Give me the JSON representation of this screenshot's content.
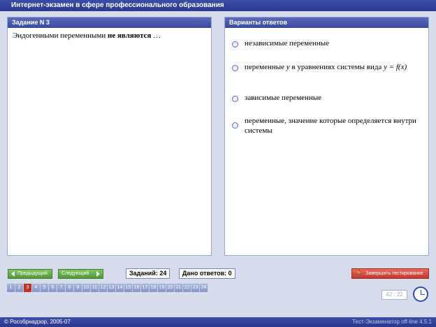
{
  "window": {
    "title": "Интернет-экзамен в сфере профессионального образования"
  },
  "question_panel": {
    "header": "Задание N 3",
    "text_prefix": "Эндогенными переменными ",
    "text_bold": "не являются",
    "text_suffix": " …"
  },
  "answers_panel": {
    "header": "Варианты ответов",
    "options": [
      {
        "text": "независимые переменные"
      },
      {
        "text_prefix": "переменные ",
        "var": "y",
        "text_mid": " в уравнениях системы вида ",
        "formula": "y = f(x)"
      },
      {
        "text": "зависимые переменные"
      },
      {
        "text": "переменные, значение которые определяется внутри системы"
      }
    ]
  },
  "nav": {
    "prev_label": "Предыдущий",
    "next_label": "Следующий",
    "tasks_label": "Заданий: 24",
    "answered_label": "Дано ответов: 0",
    "finish_label": "Завершить тестирование",
    "pages": [
      "1",
      "2",
      "3",
      "4",
      "5",
      "6",
      "7",
      "8",
      "9",
      "10",
      "11",
      "12",
      "13",
      "14",
      "15",
      "16",
      "17",
      "18",
      "19",
      "20",
      "21",
      "22",
      "23",
      "24"
    ],
    "active_page": "3"
  },
  "timer": {
    "value": "42 : 22"
  },
  "status": {
    "left": "© Рособрнадзор, 2005-07",
    "left_display": "© Рособрнадзор, 2005-07",
    "right": "Тест-Экзаменатор off-line 4.5.1"
  },
  "colors": {
    "accent": "#2a3a8e",
    "finish": "#c2392e",
    "nav_buttons": "#4f9a36",
    "active_page": "#c0302a"
  }
}
